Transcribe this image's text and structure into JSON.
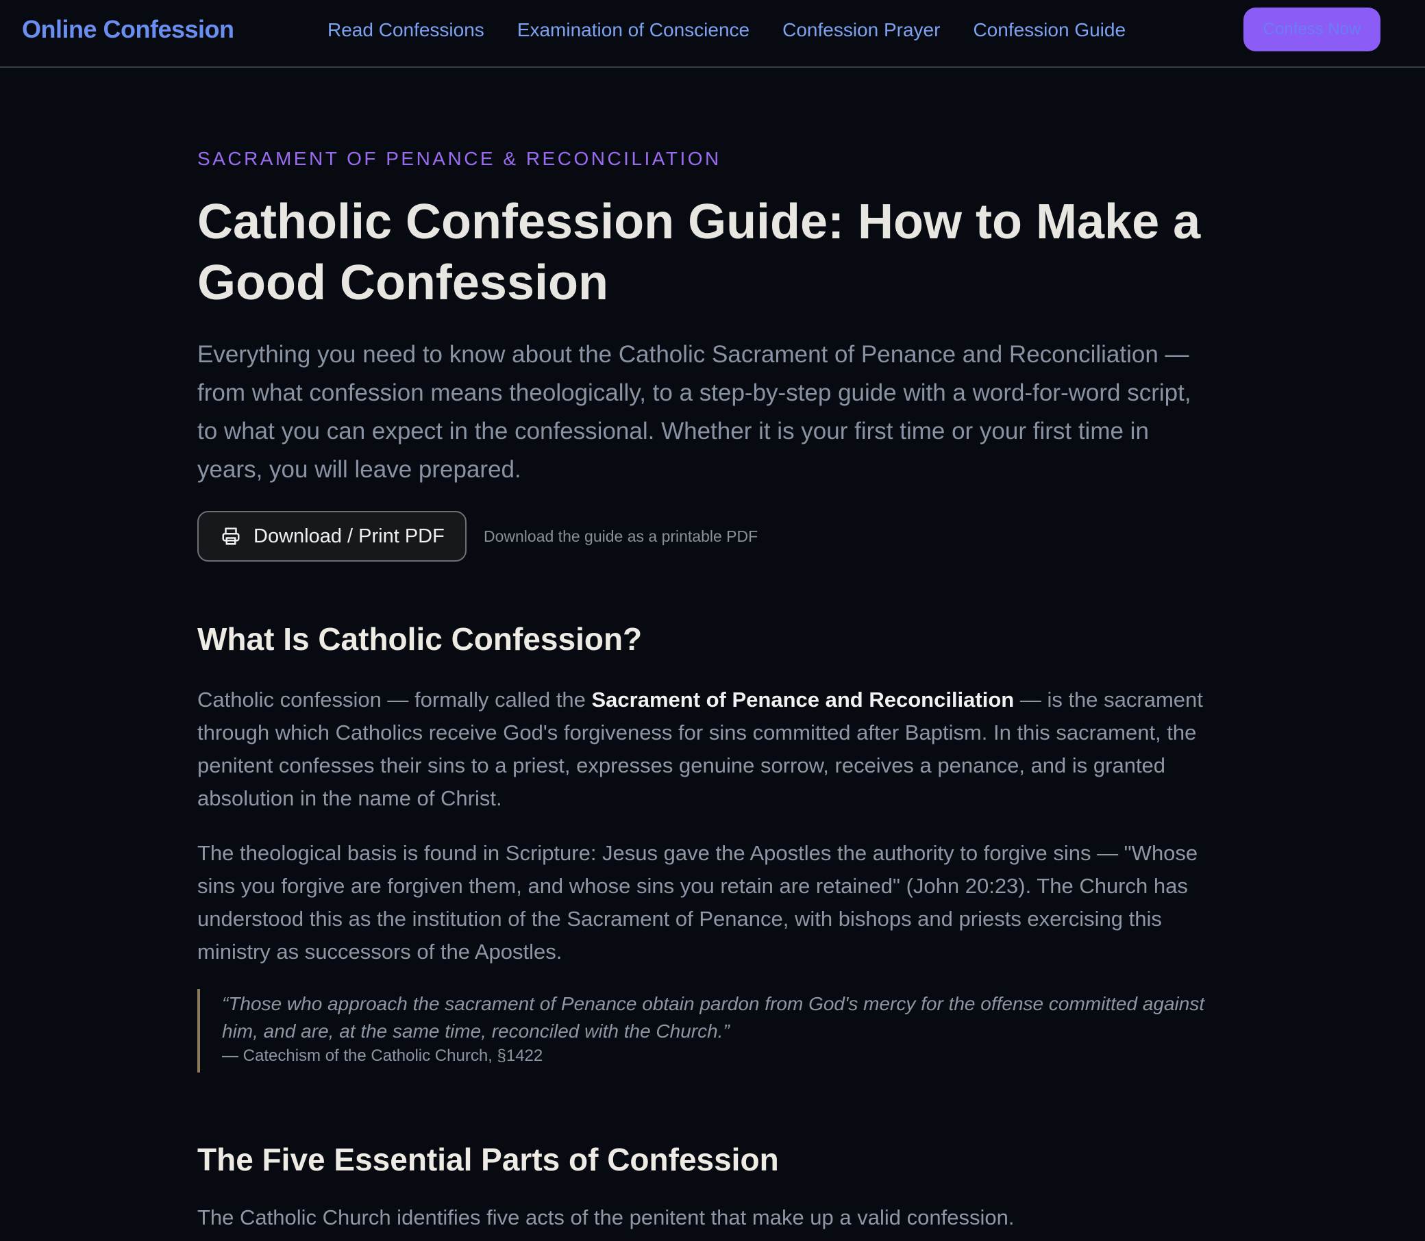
{
  "nav": {
    "logo": "Online Confession",
    "links": [
      {
        "label": "Read Confessions"
      },
      {
        "label": "Examination of Conscience"
      },
      {
        "label": "Confession Prayer"
      },
      {
        "label": "Confession Guide"
      }
    ],
    "cta_label": "Confess Now"
  },
  "hero": {
    "eyebrow": "SACRAMENT OF PENANCE & RECONCILIATION",
    "title": "Catholic Confession Guide: How to Make a Good Confession",
    "lede": "Everything you need to know about the Catholic Sacrament of Penance and Reconciliation — from what confession means theologically, to a step-by-step guide with a word-for-word script, to what you can expect in the confessional. Whether it is your first time or your first time in years, you will leave prepared.",
    "pdf_button": "Download / Print PDF",
    "pdf_note": "Download the guide as a printable PDF"
  },
  "section1": {
    "heading": "What Is Catholic Confession?",
    "p1_pre": "Catholic confession — formally called the ",
    "p1_bold": "Sacrament of Penance and Reconciliation",
    "p1_post": " — is the sacrament through which Catholics receive God's forgiveness for sins committed after Baptism. In this sacrament, the penitent confesses their sins to a priest, expresses genuine sorrow, receives a penance, and is granted absolution in the name of Christ.",
    "p2": "The theological basis is found in Scripture: Jesus gave the Apostles the authority to forgive sins — \"Whose sins you forgive are forgiven them, and whose sins you retain are retained\" (John 20:23). The Church has understood this as the institution of the Sacrament of Penance, with bishops and priests exercising this ministry as successors of the Apostles.",
    "quote": "“Those who approach the sacrament of Penance obtain pardon from God's mercy for the offense committed against him, and are, at the same time, reconciled with the Church.”",
    "cite": "— Catechism of the Catholic Church, §1422"
  },
  "section2": {
    "heading": "The Five Essential Parts of Confession",
    "intro": "The Catholic Church identifies five acts of the penitent that make up a valid confession."
  }
}
